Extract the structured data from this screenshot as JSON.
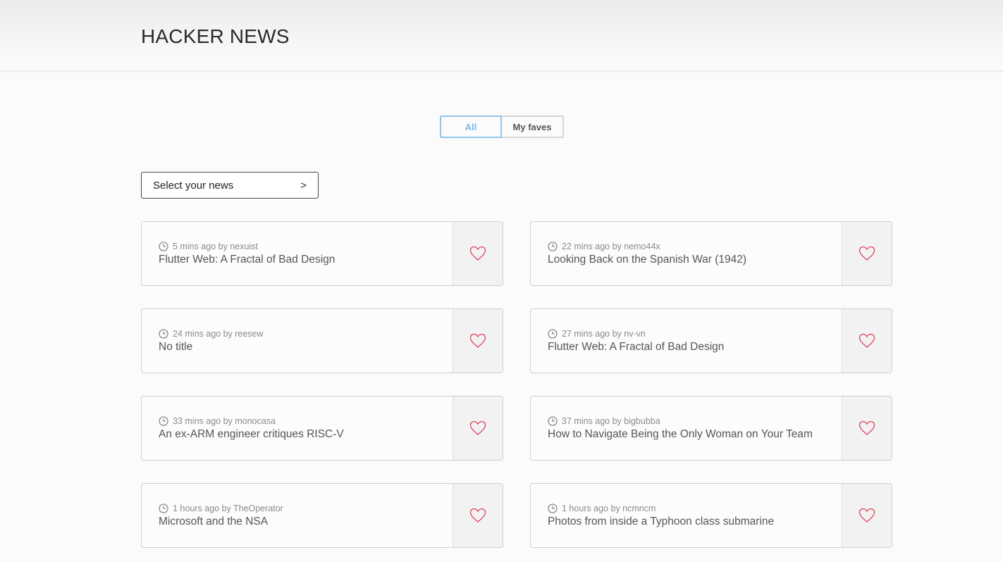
{
  "header": {
    "title": "HACKER NEWS"
  },
  "tabs": [
    {
      "label": "All",
      "active": true
    },
    {
      "label": "My faves",
      "active": false
    }
  ],
  "select": {
    "label": "Select your news",
    "chevron": ">"
  },
  "icons": {
    "clock": "clock-icon",
    "favorite": "heart-outline-icon"
  },
  "colors": {
    "accent": "#7ab8e6",
    "heart": "#e0405a",
    "meta_text": "#8a8a8a"
  },
  "news": [
    {
      "meta": "5 mins ago by nexuist",
      "title": "Flutter Web: A Fractal of Bad Design"
    },
    {
      "meta": "22 mins ago by nemo44x",
      "title": "Looking Back on the Spanish War (1942)"
    },
    {
      "meta": "24 mins ago by reesew",
      "title": "No title"
    },
    {
      "meta": "27 mins ago by nv-vn",
      "title": "Flutter Web: A Fractal of Bad Design"
    },
    {
      "meta": "33 mins ago by monocasa",
      "title": "An ex-ARM engineer critiques RISC-V"
    },
    {
      "meta": "37 mins ago by bigbubba",
      "title": "How to Navigate Being the Only Woman on Your Team"
    },
    {
      "meta": "1 hours ago by TheOperator",
      "title": "Microsoft and the NSA"
    },
    {
      "meta": "1 hours ago by ncmncm",
      "title": "Photos from inside a Typhoon class submarine"
    }
  ]
}
